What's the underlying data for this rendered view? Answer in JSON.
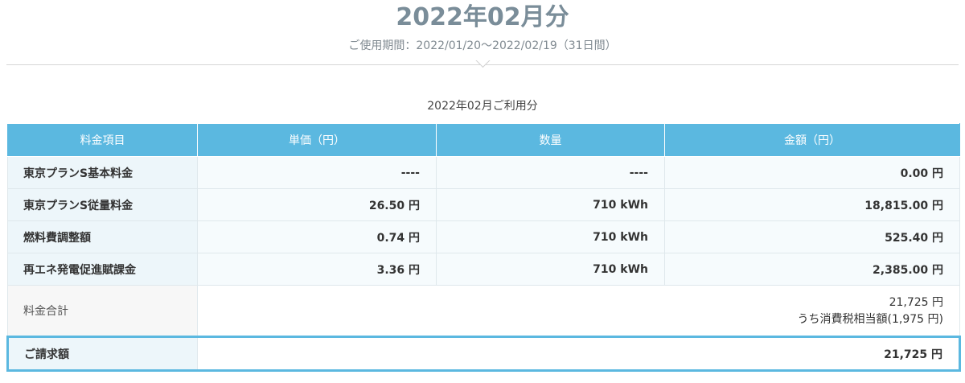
{
  "header": {
    "title": "2022年02月分",
    "period": "ご使用期間：2022/01/20～2022/02/19（31日間）"
  },
  "caption": "2022年02月ご利用分",
  "table": {
    "headers": [
      "料金項目",
      "単価（円）",
      "数量",
      "金額（円）"
    ],
    "rows": [
      {
        "item": "東京プランS基本料金",
        "unit_price": "----",
        "quantity": "----",
        "amount": "0.00 円"
      },
      {
        "item": "東京プランS従量料金",
        "unit_price": "26.50 円",
        "quantity": "710 kWh",
        "amount": "18,815.00 円"
      },
      {
        "item": "燃料費調整額",
        "unit_price": "0.74 円",
        "quantity": "710 kWh",
        "amount": "525.40 円"
      },
      {
        "item": "再エネ発電促進賦課金",
        "unit_price": "3.36 円",
        "quantity": "710 kWh",
        "amount": "2,385.00 円"
      }
    ],
    "total": {
      "label": "料金合計",
      "amount": "21,725 円",
      "tax_note": "うち消費税相当額(1,975 円)"
    },
    "billed": {
      "label": "ご請求額",
      "amount": "21,725 円"
    }
  }
}
